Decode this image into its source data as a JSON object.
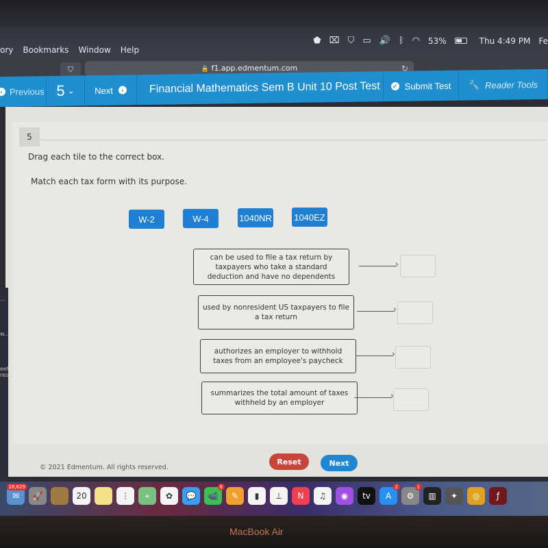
{
  "menubar": {
    "menus": [
      "ory",
      "Bookmarks",
      "Window",
      "Help"
    ],
    "status": {
      "battery_percent": "53%",
      "clock": "Thu 4:49 PM",
      "trailing": "Fe",
      "icons": [
        "shield-alert-icon",
        "screen-record-icon",
        "mcafee-icon",
        "airplay-icon",
        "volume-icon",
        "bluetooth-icon",
        "wifi-icon",
        "battery-icon"
      ]
    }
  },
  "browser": {
    "url": "f1.app.edmentum.com",
    "lock_glyph": "🔒",
    "reload_glyph": "↻",
    "shield_glyph": "⛉"
  },
  "nav": {
    "previous_label": "Previous",
    "question_number": "5",
    "next_label": "Next",
    "test_title": "Financial Mathematics Sem B Unit 10 Post Test",
    "submit_label": "Submit Test",
    "reader_tools_label": "Reader Tools"
  },
  "question": {
    "number": "5",
    "instruction": "Drag each tile to the correct box.",
    "prompt": "Match each tax form with its purpose.",
    "tiles": [
      "W-2",
      "W-4",
      "1040NR",
      "1040EZ"
    ],
    "descriptions": [
      "can be used to file a tax return by taxpayers who take a standard deduction and have no dependents",
      "used by nonresident US taxpayers to file a tax return",
      "authorizes an employer to withhold taxes from an employee's paycheck",
      "summarizes the total amount of taxes withheld by an employer"
    ],
    "reset_label": "Reset",
    "next_label": "Next"
  },
  "sidepanel": {
    "snippets": [
      "...",
      "w...",
      "eet",
      "res..."
    ]
  },
  "footer": {
    "copyright": "© 2021 Edmentum. All rights reserved."
  },
  "dock": {
    "items": [
      {
        "name": "mail",
        "glyph": "✉",
        "color": "#5a8fd0",
        "badge": "28,629"
      },
      {
        "name": "launchpad",
        "glyph": "🚀",
        "color": "#888"
      },
      {
        "name": "notebook",
        "glyph": "",
        "color": "#a07a40"
      },
      {
        "name": "calendar",
        "glyph": "20",
        "color": "#f4f4f4"
      },
      {
        "name": "notes",
        "glyph": "",
        "color": "#f2e08a"
      },
      {
        "name": "reminders",
        "glyph": "⋮",
        "color": "#f4f4f4"
      },
      {
        "name": "maps",
        "glyph": "⌖",
        "color": "#7ac080"
      },
      {
        "name": "photos",
        "glyph": "✿",
        "color": "#f4f4f4"
      },
      {
        "name": "messages",
        "glyph": "💬",
        "color": "#3a9ef0"
      },
      {
        "name": "facetime",
        "glyph": "📹",
        "color": "#3cc054",
        "badge": "6"
      },
      {
        "name": "pages",
        "glyph": "✎",
        "color": "#f0a030"
      },
      {
        "name": "numbers",
        "glyph": "▮",
        "color": "#f4f4f4"
      },
      {
        "name": "keynote",
        "glyph": "⊥",
        "color": "#f4f4f4"
      },
      {
        "name": "news",
        "glyph": "N",
        "color": "#f04050"
      },
      {
        "name": "music",
        "glyph": "♫",
        "color": "#f4f4f4"
      },
      {
        "name": "podcasts",
        "glyph": "◉",
        "color": "#a050e0"
      },
      {
        "name": "tv",
        "glyph": "tv",
        "color": "#111"
      },
      {
        "name": "app-store",
        "glyph": "A",
        "color": "#2a90f0",
        "badge": "2"
      },
      {
        "name": "system-preferences",
        "glyph": "⚙",
        "color": "#888",
        "badge": "1"
      },
      {
        "name": "piano",
        "glyph": "▥",
        "color": "#222"
      },
      {
        "name": "compass",
        "glyph": "✦",
        "color": "#555"
      },
      {
        "name": "chrome",
        "glyph": "◎",
        "color": "#e0a020"
      },
      {
        "name": "flash",
        "glyph": "ƒ",
        "color": "#701820"
      }
    ]
  },
  "device_label": "MacBook Air"
}
